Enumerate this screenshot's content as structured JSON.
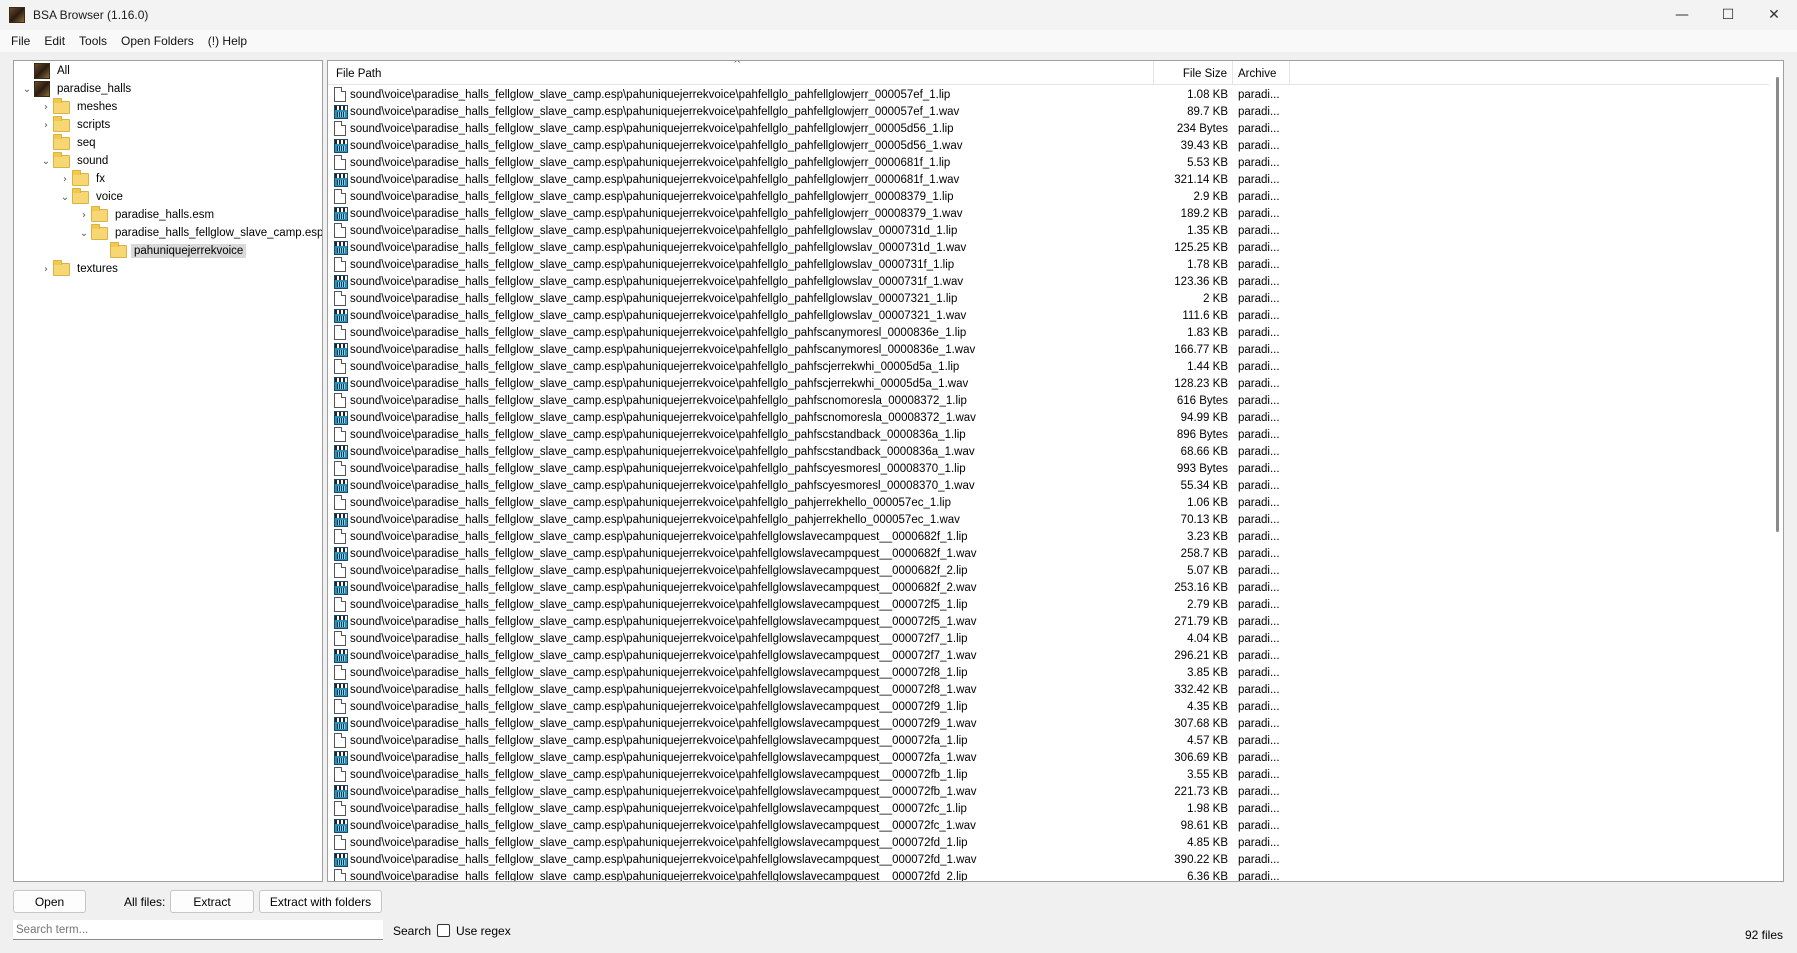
{
  "window": {
    "title": "BSA Browser (1.16.0)",
    "minimize": "—",
    "maximize": "☐",
    "close": "✕"
  },
  "menu": [
    "File",
    "Edit",
    "Tools",
    "Open Folders",
    "(!) Help"
  ],
  "tree": [
    {
      "label": "All",
      "level": 0,
      "icon": "archive-icon",
      "expander": ""
    },
    {
      "label": "paradise_halls",
      "level": 0,
      "icon": "archive-icon",
      "expander": "⌄"
    },
    {
      "label": "meshes",
      "level": 1,
      "icon": "folder-icon",
      "expander": "›"
    },
    {
      "label": "scripts",
      "level": 1,
      "icon": "folder-icon",
      "expander": "›"
    },
    {
      "label": "seq",
      "level": 1,
      "icon": "folder-icon",
      "expander": ""
    },
    {
      "label": "sound",
      "level": 1,
      "icon": "folder-icon",
      "expander": "⌄"
    },
    {
      "label": "fx",
      "level": 2,
      "icon": "folder-icon",
      "expander": "›"
    },
    {
      "label": "voice",
      "level": 2,
      "icon": "folder-icon",
      "expander": "⌄"
    },
    {
      "label": "paradise_halls.esm",
      "level": 3,
      "icon": "folder-icon",
      "expander": "›"
    },
    {
      "label": "paradise_halls_fellglow_slave_camp.esp",
      "level": 3,
      "icon": "folder-icon",
      "expander": "⌄"
    },
    {
      "label": "pahuniquejerrekvoice",
      "level": 4,
      "icon": "folder-icon",
      "expander": "",
      "selected": true
    },
    {
      "label": "textures",
      "level": 1,
      "icon": "folder-icon",
      "expander": "›"
    }
  ],
  "columns": {
    "path": "File Path",
    "size": "File Size",
    "archive": "Archive",
    "sort_indicator": "^"
  },
  "files": [
    {
      "path": "sound\\voice\\paradise_halls_fellglow_slave_camp.esp\\pahuniquejerrekvoice\\pahfellglo_pahfellglowjerr_000057ef_1.lip",
      "size": "1.08 KB",
      "archive": "paradi..."
    },
    {
      "path": "sound\\voice\\paradise_halls_fellglow_slave_camp.esp\\pahuniquejerrekvoice\\pahfellglo_pahfellglowjerr_000057ef_1.wav",
      "size": "89.7 KB",
      "archive": "paradi..."
    },
    {
      "path": "sound\\voice\\paradise_halls_fellglow_slave_camp.esp\\pahuniquejerrekvoice\\pahfellglo_pahfellglowjerr_00005d56_1.lip",
      "size": "234 Bytes",
      "archive": "paradi..."
    },
    {
      "path": "sound\\voice\\paradise_halls_fellglow_slave_camp.esp\\pahuniquejerrekvoice\\pahfellglo_pahfellglowjerr_00005d56_1.wav",
      "size": "39.43 KB",
      "archive": "paradi..."
    },
    {
      "path": "sound\\voice\\paradise_halls_fellglow_slave_camp.esp\\pahuniquejerrekvoice\\pahfellglo_pahfellglowjerr_0000681f_1.lip",
      "size": "5.53 KB",
      "archive": "paradi..."
    },
    {
      "path": "sound\\voice\\paradise_halls_fellglow_slave_camp.esp\\pahuniquejerrekvoice\\pahfellglo_pahfellglowjerr_0000681f_1.wav",
      "size": "321.14 KB",
      "archive": "paradi..."
    },
    {
      "path": "sound\\voice\\paradise_halls_fellglow_slave_camp.esp\\pahuniquejerrekvoice\\pahfellglo_pahfellglowjerr_00008379_1.lip",
      "size": "2.9 KB",
      "archive": "paradi..."
    },
    {
      "path": "sound\\voice\\paradise_halls_fellglow_slave_camp.esp\\pahuniquejerrekvoice\\pahfellglo_pahfellglowjerr_00008379_1.wav",
      "size": "189.2 KB",
      "archive": "paradi..."
    },
    {
      "path": "sound\\voice\\paradise_halls_fellglow_slave_camp.esp\\pahuniquejerrekvoice\\pahfellglo_pahfellglowslav_0000731d_1.lip",
      "size": "1.35 KB",
      "archive": "paradi..."
    },
    {
      "path": "sound\\voice\\paradise_halls_fellglow_slave_camp.esp\\pahuniquejerrekvoice\\pahfellglo_pahfellglowslav_0000731d_1.wav",
      "size": "125.25 KB",
      "archive": "paradi..."
    },
    {
      "path": "sound\\voice\\paradise_halls_fellglow_slave_camp.esp\\pahuniquejerrekvoice\\pahfellglo_pahfellglowslav_0000731f_1.lip",
      "size": "1.78 KB",
      "archive": "paradi..."
    },
    {
      "path": "sound\\voice\\paradise_halls_fellglow_slave_camp.esp\\pahuniquejerrekvoice\\pahfellglo_pahfellglowslav_0000731f_1.wav",
      "size": "123.36 KB",
      "archive": "paradi..."
    },
    {
      "path": "sound\\voice\\paradise_halls_fellglow_slave_camp.esp\\pahuniquejerrekvoice\\pahfellglo_pahfellglowslav_00007321_1.lip",
      "size": "2 KB",
      "archive": "paradi..."
    },
    {
      "path": "sound\\voice\\paradise_halls_fellglow_slave_camp.esp\\pahuniquejerrekvoice\\pahfellglo_pahfellglowslav_00007321_1.wav",
      "size": "111.6 KB",
      "archive": "paradi..."
    },
    {
      "path": "sound\\voice\\paradise_halls_fellglow_slave_camp.esp\\pahuniquejerrekvoice\\pahfellglo_pahfscanymoresl_0000836e_1.lip",
      "size": "1.83 KB",
      "archive": "paradi..."
    },
    {
      "path": "sound\\voice\\paradise_halls_fellglow_slave_camp.esp\\pahuniquejerrekvoice\\pahfellglo_pahfscanymoresl_0000836e_1.wav",
      "size": "166.77 KB",
      "archive": "paradi..."
    },
    {
      "path": "sound\\voice\\paradise_halls_fellglow_slave_camp.esp\\pahuniquejerrekvoice\\pahfellglo_pahfscjerrekwhi_00005d5a_1.lip",
      "size": "1.44 KB",
      "archive": "paradi..."
    },
    {
      "path": "sound\\voice\\paradise_halls_fellglow_slave_camp.esp\\pahuniquejerrekvoice\\pahfellglo_pahfscjerrekwhi_00005d5a_1.wav",
      "size": "128.23 KB",
      "archive": "paradi..."
    },
    {
      "path": "sound\\voice\\paradise_halls_fellglow_slave_camp.esp\\pahuniquejerrekvoice\\pahfellglo_pahfscnomoresla_00008372_1.lip",
      "size": "616 Bytes",
      "archive": "paradi..."
    },
    {
      "path": "sound\\voice\\paradise_halls_fellglow_slave_camp.esp\\pahuniquejerrekvoice\\pahfellglo_pahfscnomoresla_00008372_1.wav",
      "size": "94.99 KB",
      "archive": "paradi..."
    },
    {
      "path": "sound\\voice\\paradise_halls_fellglow_slave_camp.esp\\pahuniquejerrekvoice\\pahfellglo_pahfscstandback_0000836a_1.lip",
      "size": "896 Bytes",
      "archive": "paradi..."
    },
    {
      "path": "sound\\voice\\paradise_halls_fellglow_slave_camp.esp\\pahuniquejerrekvoice\\pahfellglo_pahfscstandback_0000836a_1.wav",
      "size": "68.66 KB",
      "archive": "paradi..."
    },
    {
      "path": "sound\\voice\\paradise_halls_fellglow_slave_camp.esp\\pahuniquejerrekvoice\\pahfellglo_pahfscyesmoresl_00008370_1.lip",
      "size": "993 Bytes",
      "archive": "paradi..."
    },
    {
      "path": "sound\\voice\\paradise_halls_fellglow_slave_camp.esp\\pahuniquejerrekvoice\\pahfellglo_pahfscyesmoresl_00008370_1.wav",
      "size": "55.34 KB",
      "archive": "paradi..."
    },
    {
      "path": "sound\\voice\\paradise_halls_fellglow_slave_camp.esp\\pahuniquejerrekvoice\\pahfellglo_pahjerrekhello_000057ec_1.lip",
      "size": "1.06 KB",
      "archive": "paradi..."
    },
    {
      "path": "sound\\voice\\paradise_halls_fellglow_slave_camp.esp\\pahuniquejerrekvoice\\pahfellglo_pahjerrekhello_000057ec_1.wav",
      "size": "70.13 KB",
      "archive": "paradi..."
    },
    {
      "path": "sound\\voice\\paradise_halls_fellglow_slave_camp.esp\\pahuniquejerrekvoice\\pahfellglowslavecampquest__0000682f_1.lip",
      "size": "3.23 KB",
      "archive": "paradi..."
    },
    {
      "path": "sound\\voice\\paradise_halls_fellglow_slave_camp.esp\\pahuniquejerrekvoice\\pahfellglowslavecampquest__0000682f_1.wav",
      "size": "258.7 KB",
      "archive": "paradi..."
    },
    {
      "path": "sound\\voice\\paradise_halls_fellglow_slave_camp.esp\\pahuniquejerrekvoice\\pahfellglowslavecampquest__0000682f_2.lip",
      "size": "5.07 KB",
      "archive": "paradi..."
    },
    {
      "path": "sound\\voice\\paradise_halls_fellglow_slave_camp.esp\\pahuniquejerrekvoice\\pahfellglowslavecampquest__0000682f_2.wav",
      "size": "253.16 KB",
      "archive": "paradi..."
    },
    {
      "path": "sound\\voice\\paradise_halls_fellglow_slave_camp.esp\\pahuniquejerrekvoice\\pahfellglowslavecampquest__000072f5_1.lip",
      "size": "2.79 KB",
      "archive": "paradi..."
    },
    {
      "path": "sound\\voice\\paradise_halls_fellglow_slave_camp.esp\\pahuniquejerrekvoice\\pahfellglowslavecampquest__000072f5_1.wav",
      "size": "271.79 KB",
      "archive": "paradi..."
    },
    {
      "path": "sound\\voice\\paradise_halls_fellglow_slave_camp.esp\\pahuniquejerrekvoice\\pahfellglowslavecampquest__000072f7_1.lip",
      "size": "4.04 KB",
      "archive": "paradi..."
    },
    {
      "path": "sound\\voice\\paradise_halls_fellglow_slave_camp.esp\\pahuniquejerrekvoice\\pahfellglowslavecampquest__000072f7_1.wav",
      "size": "296.21 KB",
      "archive": "paradi..."
    },
    {
      "path": "sound\\voice\\paradise_halls_fellglow_slave_camp.esp\\pahuniquejerrekvoice\\pahfellglowslavecampquest__000072f8_1.lip",
      "size": "3.85 KB",
      "archive": "paradi..."
    },
    {
      "path": "sound\\voice\\paradise_halls_fellglow_slave_camp.esp\\pahuniquejerrekvoice\\pahfellglowslavecampquest__000072f8_1.wav",
      "size": "332.42 KB",
      "archive": "paradi..."
    },
    {
      "path": "sound\\voice\\paradise_halls_fellglow_slave_camp.esp\\pahuniquejerrekvoice\\pahfellglowslavecampquest__000072f9_1.lip",
      "size": "4.35 KB",
      "archive": "paradi..."
    },
    {
      "path": "sound\\voice\\paradise_halls_fellglow_slave_camp.esp\\pahuniquejerrekvoice\\pahfellglowslavecampquest__000072f9_1.wav",
      "size": "307.68 KB",
      "archive": "paradi..."
    },
    {
      "path": "sound\\voice\\paradise_halls_fellglow_slave_camp.esp\\pahuniquejerrekvoice\\pahfellglowslavecampquest__000072fa_1.lip",
      "size": "4.57 KB",
      "archive": "paradi..."
    },
    {
      "path": "sound\\voice\\paradise_halls_fellglow_slave_camp.esp\\pahuniquejerrekvoice\\pahfellglowslavecampquest__000072fa_1.wav",
      "size": "306.69 KB",
      "archive": "paradi..."
    },
    {
      "path": "sound\\voice\\paradise_halls_fellglow_slave_camp.esp\\pahuniquejerrekvoice\\pahfellglowslavecampquest__000072fb_1.lip",
      "size": "3.55 KB",
      "archive": "paradi..."
    },
    {
      "path": "sound\\voice\\paradise_halls_fellglow_slave_camp.esp\\pahuniquejerrekvoice\\pahfellglowslavecampquest__000072fb_1.wav",
      "size": "221.73 KB",
      "archive": "paradi..."
    },
    {
      "path": "sound\\voice\\paradise_halls_fellglow_slave_camp.esp\\pahuniquejerrekvoice\\pahfellglowslavecampquest__000072fc_1.lip",
      "size": "1.98 KB",
      "archive": "paradi..."
    },
    {
      "path": "sound\\voice\\paradise_halls_fellglow_slave_camp.esp\\pahuniquejerrekvoice\\pahfellglowslavecampquest__000072fc_1.wav",
      "size": "98.61 KB",
      "archive": "paradi..."
    },
    {
      "path": "sound\\voice\\paradise_halls_fellglow_slave_camp.esp\\pahuniquejerrekvoice\\pahfellglowslavecampquest__000072fd_1.lip",
      "size": "4.85 KB",
      "archive": "paradi..."
    },
    {
      "path": "sound\\voice\\paradise_halls_fellglow_slave_camp.esp\\pahuniquejerrekvoice\\pahfellglowslavecampquest__000072fd_1.wav",
      "size": "390.22 KB",
      "archive": "paradi..."
    },
    {
      "path": "sound\\voice\\paradise_halls_fellglow_slave_camp.esp\\pahuniquejerrekvoice\\pahfellglowslavecampquest__000072fd_2.lip",
      "size": "6.36 KB",
      "archive": "paradi..."
    }
  ],
  "bottom": {
    "open_label": "Open",
    "all_files_label": "All files:",
    "extract_label": "Extract",
    "extract_folders_label": "Extract with folders",
    "search_placeholder": "Search term...",
    "search_label": "Search",
    "regex_label": "Use regex",
    "file_count": "92 files"
  }
}
